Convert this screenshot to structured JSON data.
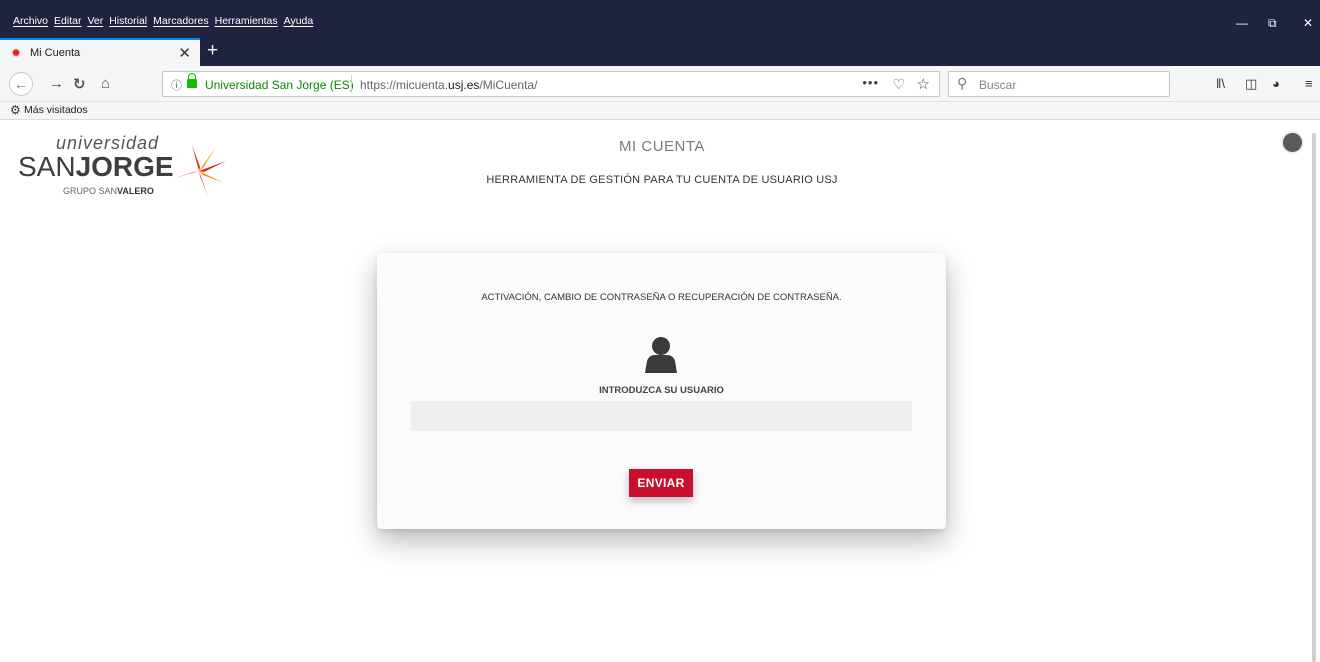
{
  "browser": {
    "menu": [
      "Archivo",
      "Editar",
      "Ver",
      "Historial",
      "Marcadores",
      "Herramientas",
      "Ayuda"
    ],
    "tab": {
      "title": "Mi Cuenta",
      "favicon": "usj-star-icon"
    },
    "address": {
      "organization": "Universidad San Jorge (ES)",
      "url_prefix": "https://micuenta.",
      "url_domain": "usj.es",
      "url_path": "/MiCuenta/"
    },
    "search": {
      "placeholder": "Buscar"
    },
    "bookmarks": {
      "most_visited": "Más visitados"
    },
    "accent_color": "#0a84ff",
    "secure_color": "#12bc00"
  },
  "page": {
    "logo": {
      "line1": "universidad",
      "san": "SAN",
      "jorge": "JORGE",
      "grupo_prefix": "GRUPO SAN",
      "grupo_bold": "VALERO"
    },
    "title": "MI CUENTA",
    "subtitle": "HERRAMIENTA DE GESTIÓN PARA TU CUENTA DE USUARIO USJ",
    "card": {
      "intro": "ACTIVACIÓN, CAMBIO DE CONTRASEÑA O RECUPERACIÓN DE CONTRASEÑA.",
      "user_label": "INTRODUZCA SU USUARIO",
      "user_value": "",
      "submit_label": "ENVIAR"
    },
    "brand_color": "#c8102e"
  }
}
